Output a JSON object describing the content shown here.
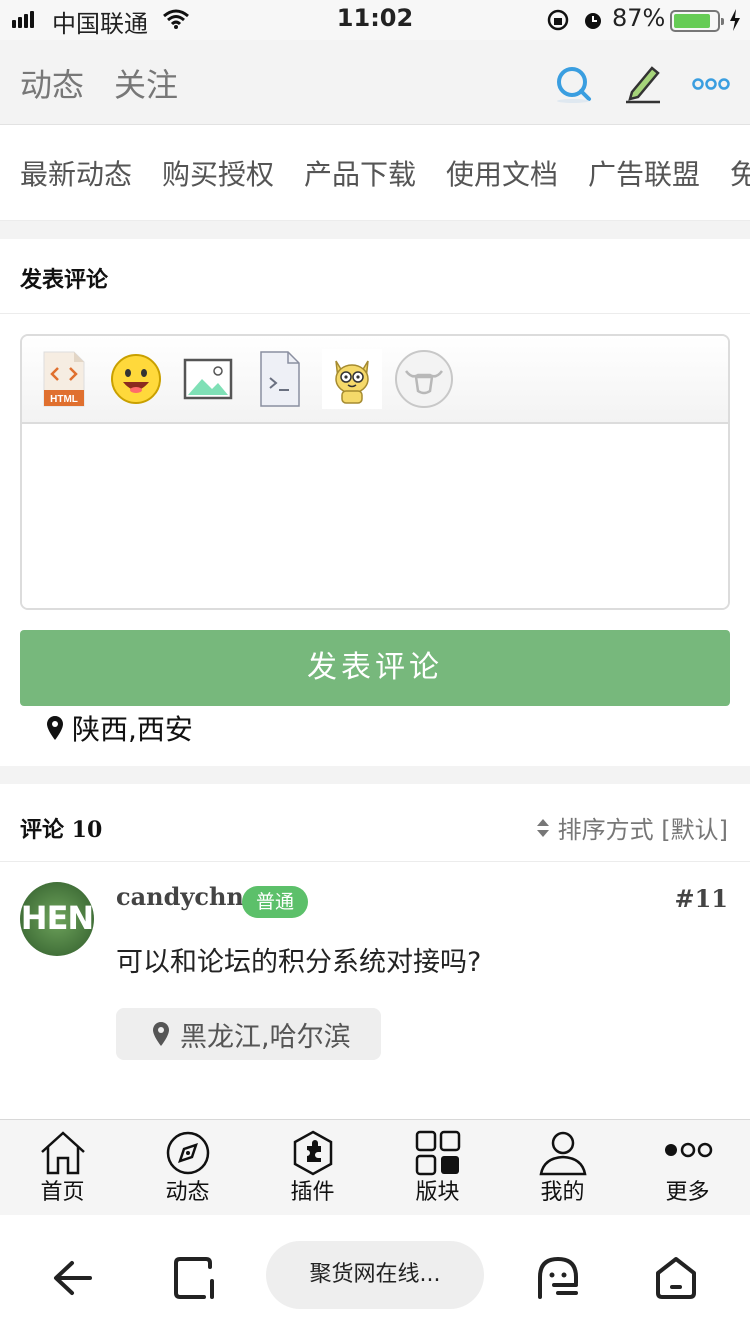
{
  "status_bar": {
    "carrier": "中国联通",
    "time": "11:02",
    "battery_percent": "87%",
    "battery_level": 0.87
  },
  "header": {
    "tabs": [
      "动态",
      "关注"
    ],
    "icons": [
      "search-icon",
      "edit-icon",
      "more-icon"
    ]
  },
  "nav": {
    "items": [
      "最新动态",
      "购买授权",
      "产品下载",
      "使用文档",
      "广告联盟",
      "免"
    ]
  },
  "comment_form": {
    "title": "发表评论",
    "toolbar_icons": [
      "html-icon",
      "smiley-icon",
      "image-icon",
      "code-icon",
      "cat-emoji-icon",
      "bull-icon"
    ],
    "submit_label": "发表评论",
    "location": "陕西,西安"
  },
  "comments": {
    "header": "评论 10",
    "sort_label": "排序方式 [默认]",
    "items": [
      {
        "avatar_text": "HEN",
        "username": "candychn",
        "badge": "普通",
        "floor": "#11",
        "content": "可以和论坛的积分系统对接吗?",
        "location": "黑龙江,哈尔滨"
      }
    ]
  },
  "tabbar": {
    "items": [
      "首页",
      "动态",
      "插件",
      "版块",
      "我的",
      "更多"
    ]
  },
  "browser": {
    "url_label": "聚货网在线..."
  },
  "colors": {
    "accent_green": "#77b87c",
    "badge_green": "#5cc06a",
    "search_blue": "#3a9ee0"
  }
}
